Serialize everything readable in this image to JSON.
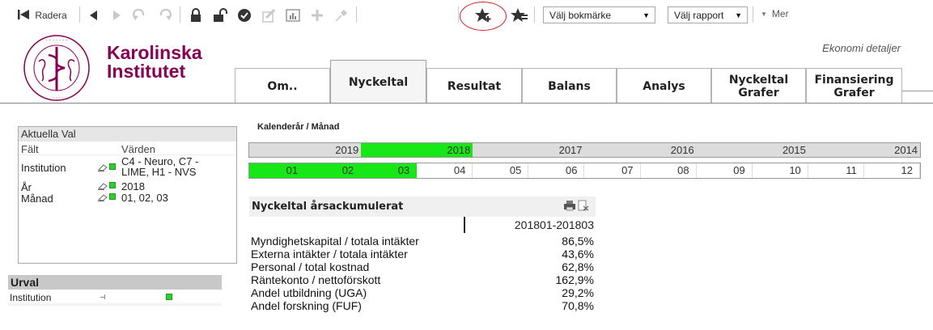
{
  "toolbar": {
    "delete_label": "Radera",
    "bookmark_select": "Välj bokmärke",
    "report_select": "Välj rapport",
    "more_label": "Mer",
    "icons": [
      "back-to-start-icon",
      "back-icon",
      "forward-icon",
      "undo-icon",
      "redo-icon",
      "lock-icon",
      "unlock-icon",
      "check-icon",
      "edit-icon",
      "chart-icon",
      "plus-icon",
      "pin-icon",
      "add-bookmark-star-icon",
      "bookmark-star-icon"
    ],
    "highlight_color": "#d42020"
  },
  "header": {
    "brand_line1": "Karolinska",
    "brand_line2": "Institutet",
    "brand_color": "#870052",
    "top_right_label": "Ekonomi detaljer"
  },
  "tabs": [
    {
      "label": "Om..",
      "active": false
    },
    {
      "label": "Nyckeltal",
      "active": true
    },
    {
      "label": "Resultat",
      "active": false
    },
    {
      "label": "Balans",
      "active": false
    },
    {
      "label": "Analys",
      "active": false
    },
    {
      "label": "Nyckeltal\nGrafer",
      "active": false
    },
    {
      "label": "Finansiering\nGrafer",
      "active": false
    }
  ],
  "aktuella_val": {
    "title": "Aktuella Val",
    "col_field": "Fält",
    "col_values": "Värden",
    "rows": [
      {
        "field": "Institution",
        "value": "C4 - Neuro, C7 -\nLIME, H1 - NVS"
      },
      {
        "field": "År",
        "value": "2018"
      },
      {
        "field": "Månad",
        "value": "01, 02, 03"
      }
    ]
  },
  "urval": {
    "title": "Urval",
    "field": "Institution"
  },
  "calendar": {
    "label": "Kalenderår / Månad",
    "years": [
      "2019",
      "2018",
      "2017",
      "2016",
      "2015",
      "2014"
    ],
    "selected_year": "2018",
    "months": [
      "01",
      "02",
      "03",
      "04",
      "05",
      "06",
      "07",
      "08",
      "09",
      "10",
      "11",
      "12"
    ],
    "selected_months": [
      "01",
      "02",
      "03"
    ],
    "selected_color": "#17e617"
  },
  "kpi_table": {
    "title": "Nyckeltal årsackumulerat",
    "period": "201801-201803",
    "rows": [
      {
        "name": "Myndighetskapital / totala intäkter",
        "value": "86,5%"
      },
      {
        "name": "Externa intäkter / totala intäkter",
        "value": "43,6%"
      },
      {
        "name": "Personal / total kostnad",
        "value": "62,8%"
      },
      {
        "name": "Räntekonto / nettoförskott",
        "value": "162,9%"
      },
      {
        "name": "Andel utbildning (UGA)",
        "value": "29,2%"
      },
      {
        "name": "Andel forskning (FUF)",
        "value": "70,8%"
      }
    ]
  }
}
